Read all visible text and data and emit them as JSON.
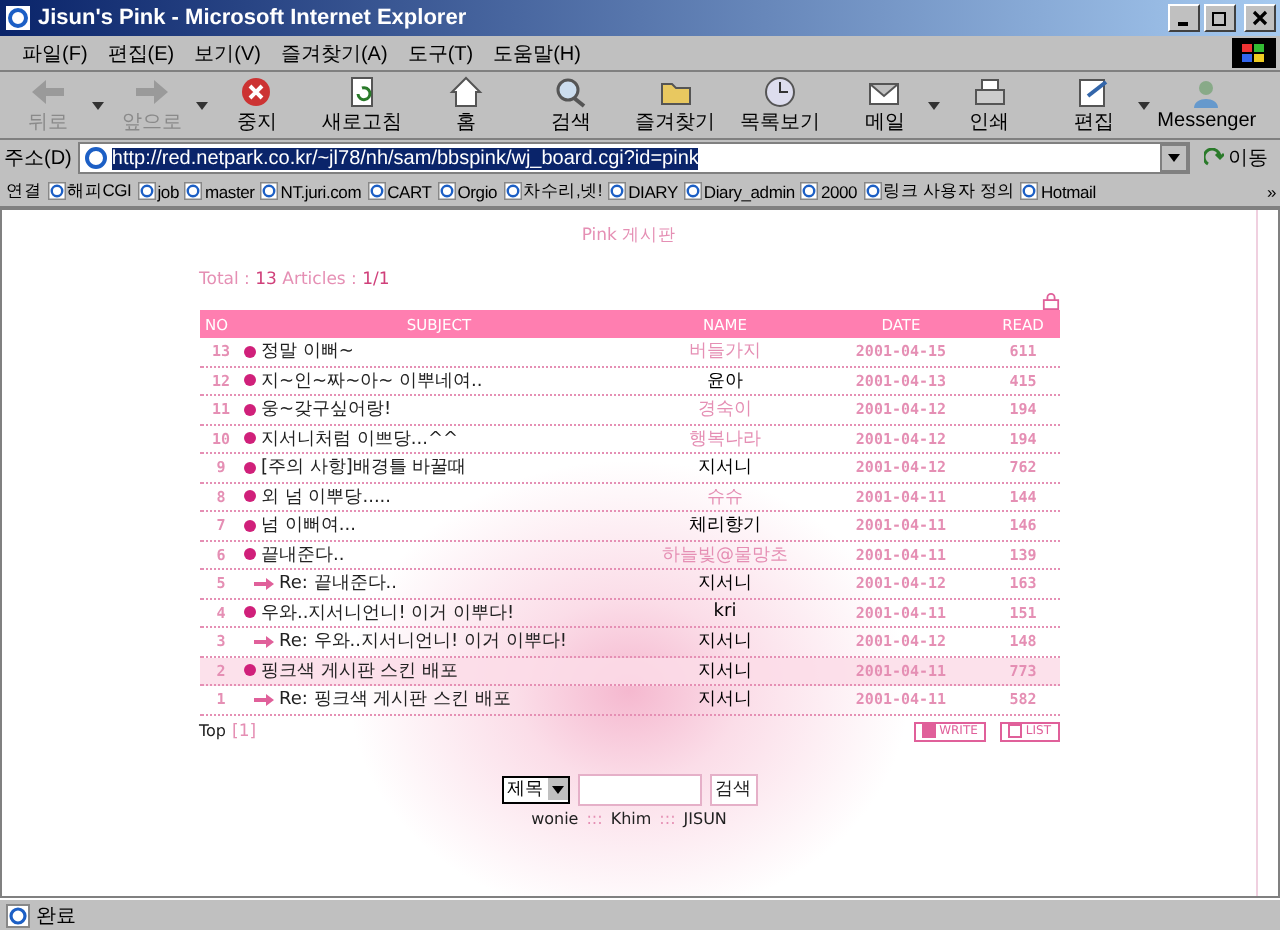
{
  "window": {
    "title": "Jisun's Pink - Microsoft Internet Explorer"
  },
  "menu": [
    "파일(F)",
    "편집(E)",
    "보기(V)",
    "즐겨찾기(A)",
    "도구(T)",
    "도움말(H)"
  ],
  "toolbar": [
    {
      "label": "뒤로",
      "kind": "back",
      "disabled": true,
      "dropdown": true
    },
    {
      "label": "앞으로",
      "kind": "forward",
      "disabled": true,
      "dropdown": true
    },
    {
      "label": "중지",
      "kind": "stop",
      "disabled": false,
      "dropdown": false
    },
    {
      "label": "새로고침",
      "kind": "refresh",
      "disabled": false,
      "dropdown": false
    },
    {
      "label": "홈",
      "kind": "home",
      "disabled": false,
      "dropdown": false
    },
    {
      "label": "검색",
      "kind": "search",
      "disabled": false,
      "dropdown": false
    },
    {
      "label": "즐겨찾기",
      "kind": "favorites",
      "disabled": false,
      "dropdown": false
    },
    {
      "label": "목록보기",
      "kind": "history",
      "disabled": false,
      "dropdown": false
    },
    {
      "label": "메일",
      "kind": "mail",
      "disabled": false,
      "dropdown": true
    },
    {
      "label": "인쇄",
      "kind": "print",
      "disabled": false,
      "dropdown": false
    },
    {
      "label": "편집",
      "kind": "edit",
      "disabled": false,
      "dropdown": true
    },
    {
      "label": "Messenger",
      "kind": "messenger",
      "disabled": false,
      "dropdown": false
    }
  ],
  "address": {
    "label": "주소(D)",
    "value": "http://red.netpark.co.kr/~jl78/nh/sam/bbspink/wj_board.cgi?id=pink",
    "go": "이동"
  },
  "links": {
    "label": "연결",
    "items": [
      "해피CGI",
      "job",
      "master",
      "NT.juri.com",
      "CART",
      "Orgio",
      "차수리,넷!",
      "DIARY",
      "Diary_admin",
      "2000",
      "링크 사용자 정의",
      "Hotmail"
    ],
    "more": "»"
  },
  "board": {
    "title": "Pink 게시판",
    "total_label": "Total :",
    "total": "13",
    "articles_label": "Articles :",
    "pages": "1/1",
    "columns": [
      "NO",
      "SUBJECT",
      "NAME",
      "DATE",
      "READ"
    ],
    "rows": [
      {
        "no": "13",
        "subject": "정말 이뻐~",
        "kind": "post",
        "name": "버들가지",
        "color": "#e58fb4",
        "date": "2001-04-15",
        "read": "611",
        "selected": false
      },
      {
        "no": "12",
        "subject": "지~인~짜~아~ 이뿌네여..",
        "kind": "post",
        "name": "윤아",
        "color": "#000000",
        "date": "2001-04-13",
        "read": "415",
        "selected": false
      },
      {
        "no": "11",
        "subject": "웅~갖구싶어랑!",
        "kind": "post",
        "name": "경숙이",
        "color": "#e58fb4",
        "date": "2001-04-12",
        "read": "194",
        "selected": false
      },
      {
        "no": "10",
        "subject": "지서니처럼 이쁘당...^^",
        "kind": "post",
        "name": "행복나라",
        "color": "#e58fb4",
        "date": "2001-04-12",
        "read": "194",
        "selected": false
      },
      {
        "no": "9",
        "subject": "[주의 사항]배경틀 바꿀때",
        "kind": "post",
        "name": "지서니",
        "color": "#000000",
        "date": "2001-04-12",
        "read": "762",
        "selected": false
      },
      {
        "no": "8",
        "subject": "외 넘 이뿌당.....",
        "kind": "post",
        "name": "슈슈",
        "color": "#e58fb4",
        "date": "2001-04-11",
        "read": "144",
        "selected": false
      },
      {
        "no": "7",
        "subject": "넘 이뻐여...",
        "kind": "post",
        "name": "체리향기",
        "color": "#000000",
        "date": "2001-04-11",
        "read": "146",
        "selected": false
      },
      {
        "no": "6",
        "subject": "끝내준다..",
        "kind": "post",
        "name": "하늘빛@물망초",
        "color": "#e58fb4",
        "date": "2001-04-11",
        "read": "139",
        "selected": false
      },
      {
        "no": "5",
        "subject": "Re: 끝내준다..",
        "kind": "reply",
        "name": "지서니",
        "color": "#000000",
        "date": "2001-04-12",
        "read": "163",
        "selected": false
      },
      {
        "no": "4",
        "subject": "우와..지서니언니! 이거 이뿌다!",
        "kind": "post",
        "name": "kri",
        "color": "#000000",
        "date": "2001-04-11",
        "read": "151",
        "selected": false
      },
      {
        "no": "3",
        "subject": "Re: 우와..지서니언니! 이거 이뿌다!",
        "kind": "reply",
        "name": "지서니",
        "color": "#000000",
        "date": "2001-04-12",
        "read": "148",
        "selected": false
      },
      {
        "no": "2",
        "subject": "핑크색 게시판 스킨 배포",
        "kind": "post",
        "name": "지서니",
        "color": "#000000",
        "date": "2001-04-11",
        "read": "773",
        "selected": true
      },
      {
        "no": "1",
        "subject": "Re: 핑크색 게시판 스킨 배포",
        "kind": "reply",
        "name": "지서니",
        "color": "#000000",
        "date": "2001-04-11",
        "read": "582",
        "selected": false
      }
    ],
    "top": "Top",
    "page": "[1]",
    "write": "WRITE",
    "list": "LIST",
    "search": {
      "select": "제목",
      "button": "검색"
    },
    "credits": [
      {
        "text": "wonie"
      },
      {
        "text": ":::",
        "kind": "sep"
      },
      {
        "text": "Khim"
      },
      {
        "text": ":::",
        "kind": "sep"
      },
      {
        "text": "JISUN"
      }
    ]
  },
  "status": {
    "text": "완료"
  }
}
